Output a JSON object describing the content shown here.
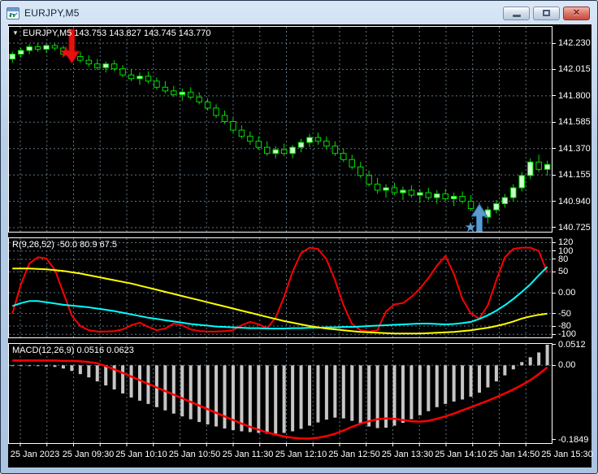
{
  "window": {
    "title": "EURJPY,M5",
    "icons": {
      "window_icon": "chart-window-icon",
      "minimize": "minimize-icon",
      "restore": "restore-icon",
      "close": "close-icon"
    }
  },
  "chart": {
    "dropdown_glyph": "▼",
    "colors": {
      "background": "#000000",
      "border": "#ffffff",
      "grid": "#5e7280",
      "candle_outline": "#00df00",
      "bull_fill": "#ccffcc",
      "bear_fill": "#000000",
      "osc_fast": "#ff0000",
      "osc_mid": "#00ffff",
      "osc_slow": "#ffff00",
      "macd_histogram": "#c6c6c6",
      "macd_signal": "#ff0000",
      "sell_signal": "#e81010",
      "buy_signal": "#5b9ccd"
    }
  },
  "time_axis": {
    "labels": [
      "25 Jan 2023",
      "25 Jan 09:30",
      "25 Jan 10:10",
      "25 Jan 10:50",
      "25 Jan 11:30",
      "25 Jan 12:10",
      "25 Jan 12:50",
      "25 Jan 13:30",
      "25 Jan 14:10",
      "25 Jan 14:50",
      "25 Jan 15:30"
    ]
  },
  "chart_data": [
    {
      "type": "candlestick",
      "title": "EURJPY,M5 143.753 143.827 143.745 143.770",
      "symbol": "EURJPY",
      "timeframe": "M5",
      "ohlc_readout": {
        "open": "143.753",
        "high": "143.827",
        "low": "143.745",
        "close": "143.770"
      },
      "price_scale": [
        142.23,
        142.015,
        141.8,
        141.585,
        141.37,
        141.155,
        140.94,
        140.725
      ],
      "ylim": [
        140.7,
        142.33
      ],
      "grid": true,
      "candles": [
        [
          142.1,
          142.16,
          142.07,
          142.14
        ],
        [
          142.14,
          142.19,
          142.11,
          142.17
        ],
        [
          142.17,
          142.22,
          142.14,
          142.2
        ],
        [
          142.2,
          142.23,
          142.16,
          142.18
        ],
        [
          142.18,
          142.22,
          142.15,
          142.21
        ],
        [
          142.21,
          142.23,
          142.17,
          142.19
        ],
        [
          142.19,
          142.21,
          142.12,
          142.14
        ],
        [
          142.14,
          142.18,
          142.1,
          142.12
        ],
        [
          142.12,
          142.16,
          142.07,
          142.09
        ],
        [
          142.09,
          142.13,
          142.04,
          142.06
        ],
        [
          142.06,
          142.1,
          142.01,
          142.03
        ],
        [
          142.03,
          142.08,
          141.99,
          142.06
        ],
        [
          142.06,
          142.09,
          142.0,
          142.02
        ],
        [
          142.02,
          142.05,
          141.95,
          141.97
        ],
        [
          141.97,
          142.02,
          141.92,
          141.94
        ],
        [
          141.94,
          141.99,
          141.89,
          141.96
        ],
        [
          141.96,
          142.0,
          141.9,
          141.92
        ],
        [
          141.92,
          141.95,
          141.85,
          141.87
        ],
        [
          141.87,
          141.92,
          141.82,
          141.84
        ],
        [
          141.84,
          141.88,
          141.79,
          141.81
        ],
        [
          141.81,
          141.86,
          141.76,
          141.83
        ],
        [
          141.83,
          141.87,
          141.77,
          141.79
        ],
        [
          141.79,
          141.83,
          141.73,
          141.75
        ],
        [
          141.75,
          141.78,
          141.68,
          141.7
        ],
        [
          141.7,
          141.73,
          141.62,
          141.64
        ],
        [
          141.64,
          141.68,
          141.57,
          141.59
        ],
        [
          141.59,
          141.62,
          141.5,
          141.52
        ],
        [
          141.52,
          141.56,
          141.45,
          141.47
        ],
        [
          141.47,
          141.51,
          141.4,
          141.43
        ],
        [
          141.43,
          141.47,
          141.36,
          141.38
        ],
        [
          141.38,
          141.43,
          141.31,
          141.33
        ],
        [
          141.33,
          141.39,
          141.29,
          141.36
        ],
        [
          141.36,
          141.41,
          141.31,
          141.33
        ],
        [
          141.33,
          141.4,
          141.29,
          141.38
        ],
        [
          141.38,
          141.45,
          141.34,
          141.42
        ],
        [
          141.42,
          141.49,
          141.38,
          141.46
        ],
        [
          141.46,
          141.5,
          141.4,
          141.43
        ],
        [
          141.43,
          141.47,
          141.36,
          141.39
        ],
        [
          141.39,
          141.43,
          141.31,
          141.33
        ],
        [
          141.33,
          141.37,
          141.26,
          141.28
        ],
        [
          141.28,
          141.32,
          141.2,
          141.22
        ],
        [
          141.22,
          141.26,
          141.13,
          141.15
        ],
        [
          141.15,
          141.19,
          141.06,
          141.08
        ],
        [
          141.08,
          141.13,
          141.0,
          141.03
        ],
        [
          141.03,
          141.08,
          140.97,
          141.05
        ],
        [
          141.05,
          141.09,
          140.99,
          141.01
        ],
        [
          141.01,
          141.06,
          140.95,
          141.03
        ],
        [
          141.03,
          141.07,
          140.97,
          140.99
        ],
        [
          140.99,
          141.04,
          140.93,
          141.01
        ],
        [
          141.01,
          141.05,
          140.95,
          140.97
        ],
        [
          140.97,
          141.03,
          140.92,
          141.0
        ],
        [
          141.0,
          141.04,
          140.94,
          140.96
        ],
        [
          140.96,
          141.01,
          140.9,
          140.98
        ],
        [
          140.98,
          141.02,
          140.92,
          140.94
        ],
        [
          140.94,
          140.99,
          140.86,
          140.88
        ],
        [
          140.88,
          140.93,
          140.78,
          140.81
        ],
        [
          140.81,
          140.9,
          140.76,
          140.87
        ],
        [
          140.87,
          140.95,
          140.84,
          140.92
        ],
        [
          140.92,
          141.0,
          140.89,
          140.97
        ],
        [
          140.97,
          141.08,
          140.94,
          141.05
        ],
        [
          141.05,
          141.18,
          141.02,
          141.15
        ],
        [
          141.15,
          141.29,
          141.12,
          141.26
        ],
        [
          141.26,
          141.32,
          141.18,
          141.2
        ],
        [
          141.2,
          141.27,
          141.15,
          141.24
        ]
      ],
      "signals": [
        {
          "type": "sell",
          "arrow_index": 7,
          "star_index": 6,
          "color": "#e81010",
          "outline": "#8f0000"
        },
        {
          "type": "buy",
          "arrow_index": 55,
          "star_index": 54,
          "color": "#5b9ccd",
          "outline": "#2d6da8"
        }
      ]
    },
    {
      "type": "line",
      "title": "R(9,26,52) -50.0 80.9 67.5",
      "scale": [
        {
          "label": "120",
          "v": 120
        },
        {
          "label": "100",
          "v": 100
        },
        {
          "label": "80",
          "v": 80
        },
        {
          "label": "50",
          "v": 50
        },
        {
          "label": "0.00",
          "v": 0
        },
        {
          "label": "-50",
          "v": -50
        },
        {
          "label": "-80",
          "v": -80
        },
        {
          "label": "-100",
          "v": -100
        }
      ],
      "ylim": [
        -110,
        130
      ],
      "grid": true,
      "series": [
        {
          "name": "fast",
          "color": "#ff0000",
          "values": [
            -50,
            20,
            70,
            85,
            82,
            55,
            0,
            -55,
            -80,
            -90,
            -93,
            -93,
            -92,
            -88,
            -78,
            -72,
            -82,
            -90,
            -86,
            -74,
            -78,
            -88,
            -92,
            -93,
            -93,
            -92,
            -90,
            -78,
            -70,
            -76,
            -85,
            -60,
            -10,
            50,
            95,
            108,
            105,
            80,
            30,
            -30,
            -75,
            -90,
            -93,
            -90,
            -45,
            -28,
            -25,
            -10,
            10,
            35,
            65,
            88,
            45,
            -15,
            -50,
            -62,
            -30,
            30,
            85,
            105,
            108,
            108,
            100,
            48
          ]
        },
        {
          "name": "mid",
          "color": "#00ffff",
          "values": [
            -32,
            -25,
            -20,
            -20,
            -23,
            -26,
            -29,
            -31,
            -33,
            -35,
            -38,
            -41,
            -44,
            -48,
            -52,
            -56,
            -60,
            -63,
            -66,
            -69,
            -72,
            -75,
            -77,
            -79,
            -81,
            -82,
            -83,
            -84,
            -85,
            -85,
            -86,
            -86,
            -86,
            -85,
            -85,
            -84,
            -84,
            -83,
            -83,
            -82,
            -82,
            -81,
            -80,
            -79,
            -78,
            -77,
            -76,
            -75,
            -74,
            -74,
            -75,
            -76,
            -75,
            -73,
            -70,
            -63,
            -54,
            -43,
            -30,
            -15,
            2,
            20,
            42,
            62
          ]
        },
        {
          "name": "slow",
          "color": "#ffff00",
          "values": [
            58,
            58,
            58,
            57,
            56,
            54,
            52,
            49,
            46,
            42,
            38,
            34,
            30,
            26,
            22,
            17,
            12,
            7,
            2,
            -3,
            -8,
            -13,
            -18,
            -23,
            -28,
            -33,
            -38,
            -43,
            -48,
            -53,
            -58,
            -63,
            -68,
            -72,
            -76,
            -80,
            -83,
            -86,
            -88,
            -90,
            -92,
            -94,
            -95,
            -96,
            -97,
            -98,
            -98,
            -98,
            -98,
            -97,
            -96,
            -95,
            -94,
            -92,
            -90,
            -87,
            -84,
            -80,
            -75,
            -69,
            -62,
            -57,
            -53,
            -50
          ]
        }
      ]
    },
    {
      "type": "bar",
      "title": "MACD(12,26,9) 0.0516 0.0623",
      "scale": [
        {
          "label": "0.0512",
          "v": 0.0512
        },
        {
          "label": "0.00",
          "v": 0
        },
        {
          "label": "-0.1849",
          "v": -0.1849
        }
      ],
      "ylim": [
        -0.1905,
        0.0565
      ],
      "grid": true,
      "histogram": [
        -0.001,
        -0.001,
        -0.002,
        -0.002,
        -0.003,
        -0.004,
        -0.008,
        -0.014,
        -0.022,
        -0.03,
        -0.04,
        -0.05,
        -0.06,
        -0.07,
        -0.08,
        -0.088,
        -0.096,
        -0.104,
        -0.112,
        -0.12,
        -0.127,
        -0.134,
        -0.141,
        -0.147,
        -0.152,
        -0.157,
        -0.161,
        -0.164,
        -0.166,
        -0.168,
        -0.17,
        -0.17,
        -0.168,
        -0.164,
        -0.158,
        -0.15,
        -0.142,
        -0.135,
        -0.13,
        -0.132,
        -0.138,
        -0.145,
        -0.152,
        -0.156,
        -0.155,
        -0.15,
        -0.143,
        -0.134,
        -0.124,
        -0.114,
        -0.104,
        -0.096,
        -0.09,
        -0.085,
        -0.078,
        -0.068,
        -0.055,
        -0.04,
        -0.025,
        -0.01,
        0.008,
        0.02,
        0.032,
        0.0512
      ],
      "signal": [
        0.012,
        0.012,
        0.012,
        0.012,
        0.012,
        0.012,
        0.011,
        0.011,
        0.01,
        0.008,
        0.005,
        -0.002,
        -0.01,
        -0.019,
        -0.028,
        -0.037,
        -0.046,
        -0.055,
        -0.064,
        -0.073,
        -0.082,
        -0.091,
        -0.1,
        -0.109,
        -0.118,
        -0.127,
        -0.136,
        -0.145,
        -0.153,
        -0.16,
        -0.167,
        -0.172,
        -0.177,
        -0.18,
        -0.182,
        -0.182,
        -0.18,
        -0.176,
        -0.17,
        -0.162,
        -0.153,
        -0.145,
        -0.139,
        -0.134,
        -0.132,
        -0.133,
        -0.136,
        -0.139,
        -0.14,
        -0.138,
        -0.133,
        -0.127,
        -0.12,
        -0.112,
        -0.104,
        -0.096,
        -0.088,
        -0.079,
        -0.07,
        -0.06,
        -0.049,
        -0.037,
        -0.022,
        -0.005
      ]
    }
  ]
}
